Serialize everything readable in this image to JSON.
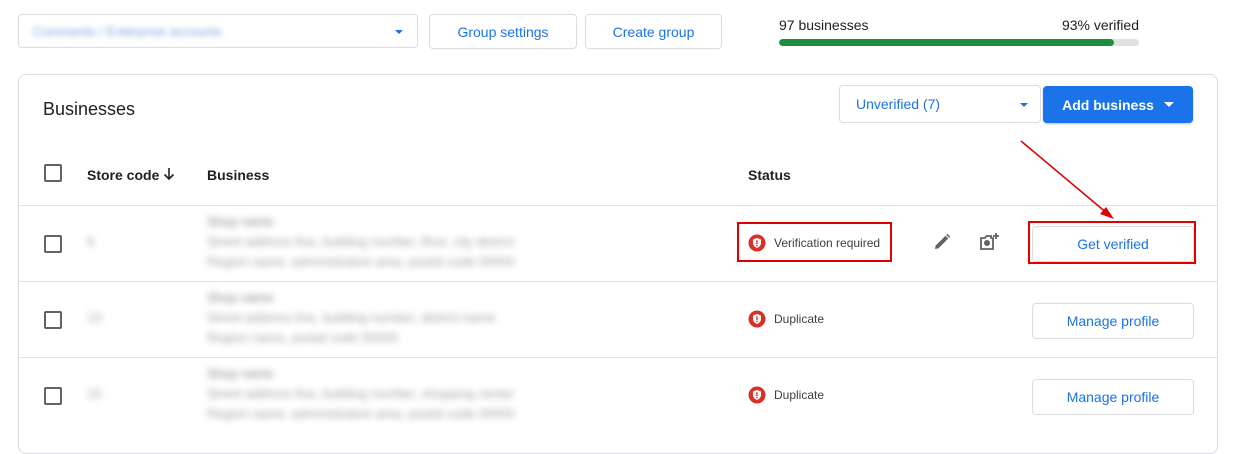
{
  "toolbar": {
    "group_select_value": "Comments / Enterprise accounts",
    "group_settings_label": "Group settings",
    "create_group_label": "Create group"
  },
  "progress": {
    "count_label": "97 businesses",
    "verified_label": "93% verified",
    "verified_fraction": 0.93,
    "fill_color": "#1e8e3e"
  },
  "card": {
    "title": "Businesses",
    "filter_value": "Unverified (7)",
    "add_business_label": "Add business"
  },
  "table": {
    "headers": {
      "store_code": "Store code",
      "business": "Business",
      "status": "Status"
    },
    "rows": [
      {
        "store_code": "6",
        "business_name": "Shop name",
        "business_address_1": "Street address line, building number, floor, city district",
        "business_address_2": "Region name, administrative area, postal code 00000",
        "status": "Verification required",
        "action": "Get verified"
      },
      {
        "store_code": "13",
        "business_name": "Shop name",
        "business_address_1": "Street address line, building number, district name",
        "business_address_2": "Region name, postal code 00000",
        "status": "Duplicate",
        "action": "Manage profile"
      },
      {
        "store_code": "15",
        "business_name": "Shop name",
        "business_address_1": "Street address line, building number, shopping center",
        "business_address_2": "Region name, administrative area, postal code 00000",
        "status": "Duplicate",
        "action": "Manage profile"
      }
    ]
  },
  "colors": {
    "accent": "#1a73e8",
    "status_error": "#d93025",
    "highlight": "#e00000"
  },
  "icons": {
    "sort": "arrow-down-icon",
    "edit": "pencil-icon",
    "add_photo": "add-photo-icon",
    "status": "shield-alert-icon"
  }
}
